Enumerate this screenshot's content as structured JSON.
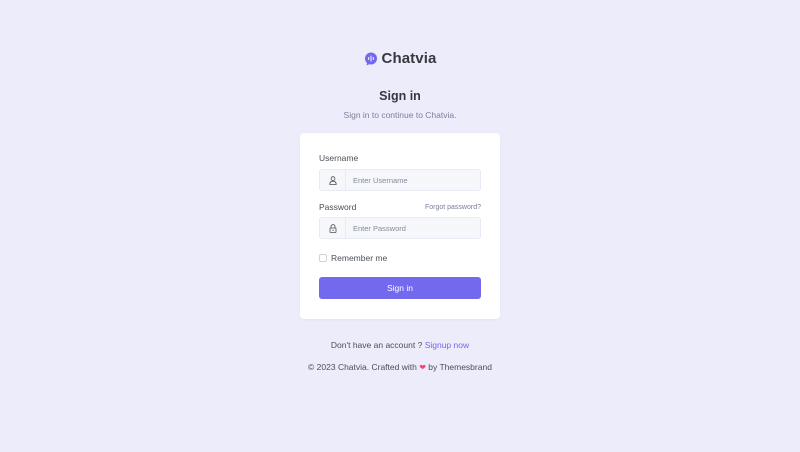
{
  "brand": {
    "name": "Chatvia",
    "accent_color": "#7269ef"
  },
  "auth": {
    "title": "Sign in",
    "subtitle": "Sign in to continue to Chatvia."
  },
  "form": {
    "username_label": "Username",
    "username_placeholder": "Enter Username",
    "username_icon": "user-icon",
    "password_label": "Password",
    "password_placeholder": "Enter Password",
    "password_icon": "lock-icon",
    "forgot_password": "Forgot password?",
    "remember_label": "Remember me",
    "remember_checked": false,
    "submit_label": "Sign in"
  },
  "signup": {
    "prompt": "Don't have an account ?",
    "link": "Signup now"
  },
  "footer": {
    "prefix": "© 2023 Chatvia. Crafted with",
    "heart": "❤",
    "suffix": "by Themesbrand",
    "heart_color": "#ef476f"
  }
}
